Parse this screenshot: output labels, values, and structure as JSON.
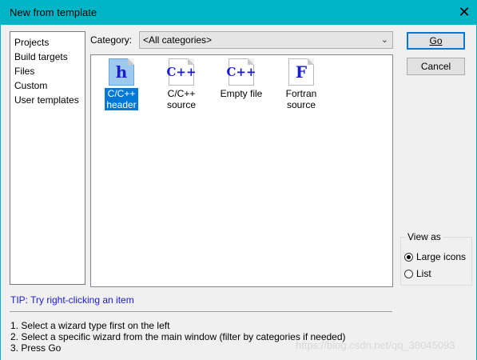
{
  "window": {
    "title": "New from template"
  },
  "sidebar": {
    "items": [
      "Projects",
      "Build targets",
      "Files",
      "Custom",
      "User templates"
    ]
  },
  "category": {
    "label": "Category:",
    "value": "<All categories>"
  },
  "templates": [
    {
      "line1": "C/C++",
      "line2": "header",
      "glyph": "h",
      "selected": true
    },
    {
      "line1": "C/C++",
      "line2": "source",
      "glyph": "C++",
      "selected": false
    },
    {
      "line1": "Empty file",
      "line2": "",
      "glyph": "C++",
      "selected": false
    },
    {
      "line1": "Fortran",
      "line2": "source",
      "glyph": "F",
      "selected": false
    }
  ],
  "buttons": {
    "go": "Go",
    "cancel": "Cancel"
  },
  "view_as": {
    "legend": "View as",
    "options": [
      "Large icons",
      "List"
    ],
    "selected": "Large icons"
  },
  "tip": "TIP: Try right-clicking an item",
  "instructions": [
    "1. Select a wizard type first on the left",
    "2. Select a specific wizard from the main window (filter by categories if needed)",
    "3. Press Go"
  ],
  "watermark": "https://blog.csdn.net/qq_38045093",
  "colors": {
    "titlebar": "#00b4c8",
    "selection": "#0078d7",
    "tip": "#1a1ad0"
  }
}
